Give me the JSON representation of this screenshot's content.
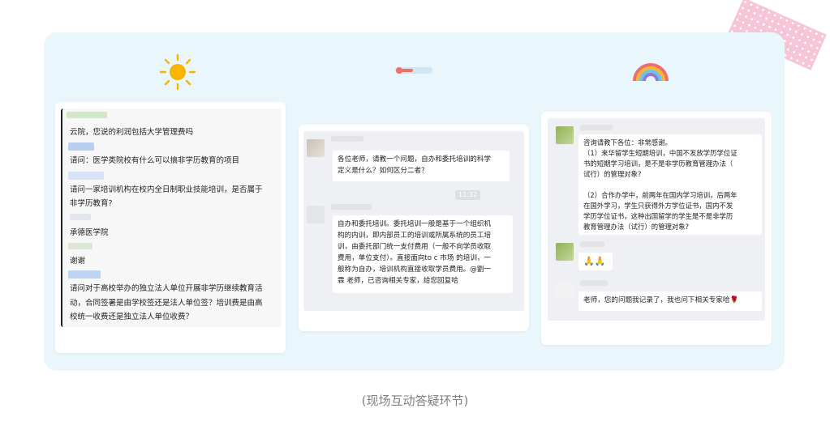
{
  "caption": "(现场互动答疑环节)",
  "icons": {
    "left": "sun-icon",
    "middle": "thermometer-icon",
    "right": "rainbow-icon"
  },
  "card1": {
    "messages": [
      "云院，您说的利润包括大学管理费吗",
      "请问：医学类院校有什么可以搞非学历教育的项目",
      "请问一家培训机构在校内全日制职业技能培训，是否属于",
      "非学历教育?",
      "承德医学院",
      "谢谢",
      "请问对于高校举办的独立法人单位开展非学历继续教育活",
      "动，合同签署是由学校签还是法人单位签？培训费是由高",
      "校统一收费还是独立法人单位收费？"
    ]
  },
  "card2": {
    "question_lines": [
      "各位老师，请教一个问题，自办和委托培训的科学",
      "定义是什么？如何区分二者？"
    ],
    "time": "11:32",
    "answer_lines": [
      "自办和委托培训。委托培训一般是基于一个组织机",
      "构的内训，即内部员工的培训或所属系统的员工培",
      "训，由委托部门统一支付费用（一般不向学员收取",
      "费用，单位支付）。直接面向to c 市场 的培训，一",
      "般称为自办，培训机构直接收取学员费用。@劉一",
      "霖 老师，已咨询相关专家，给您回复哈"
    ]
  },
  "card3": {
    "question_lines": [
      "咨询请教下各位：非常感谢。",
      "（1）来华留学生短期培训，中国不发放学历学位证",
      "书的短期学习培训，是不是非学历教育管理办法（",
      "试行）的管理对象?",
      "",
      "（2）合作办学中，前两年在国内学习培训，后两年",
      "在国外学习，学生只获得外方学位证书，国内不发",
      "学历学位证书，这种出国留学的学生是不是非学历",
      "教育管理办法（试行）的管理对象?"
    ],
    "reply_emoji": "🙏🙏",
    "reply_text": "老师，您的问题我记录了，我也问下相关专家哈🌹"
  }
}
